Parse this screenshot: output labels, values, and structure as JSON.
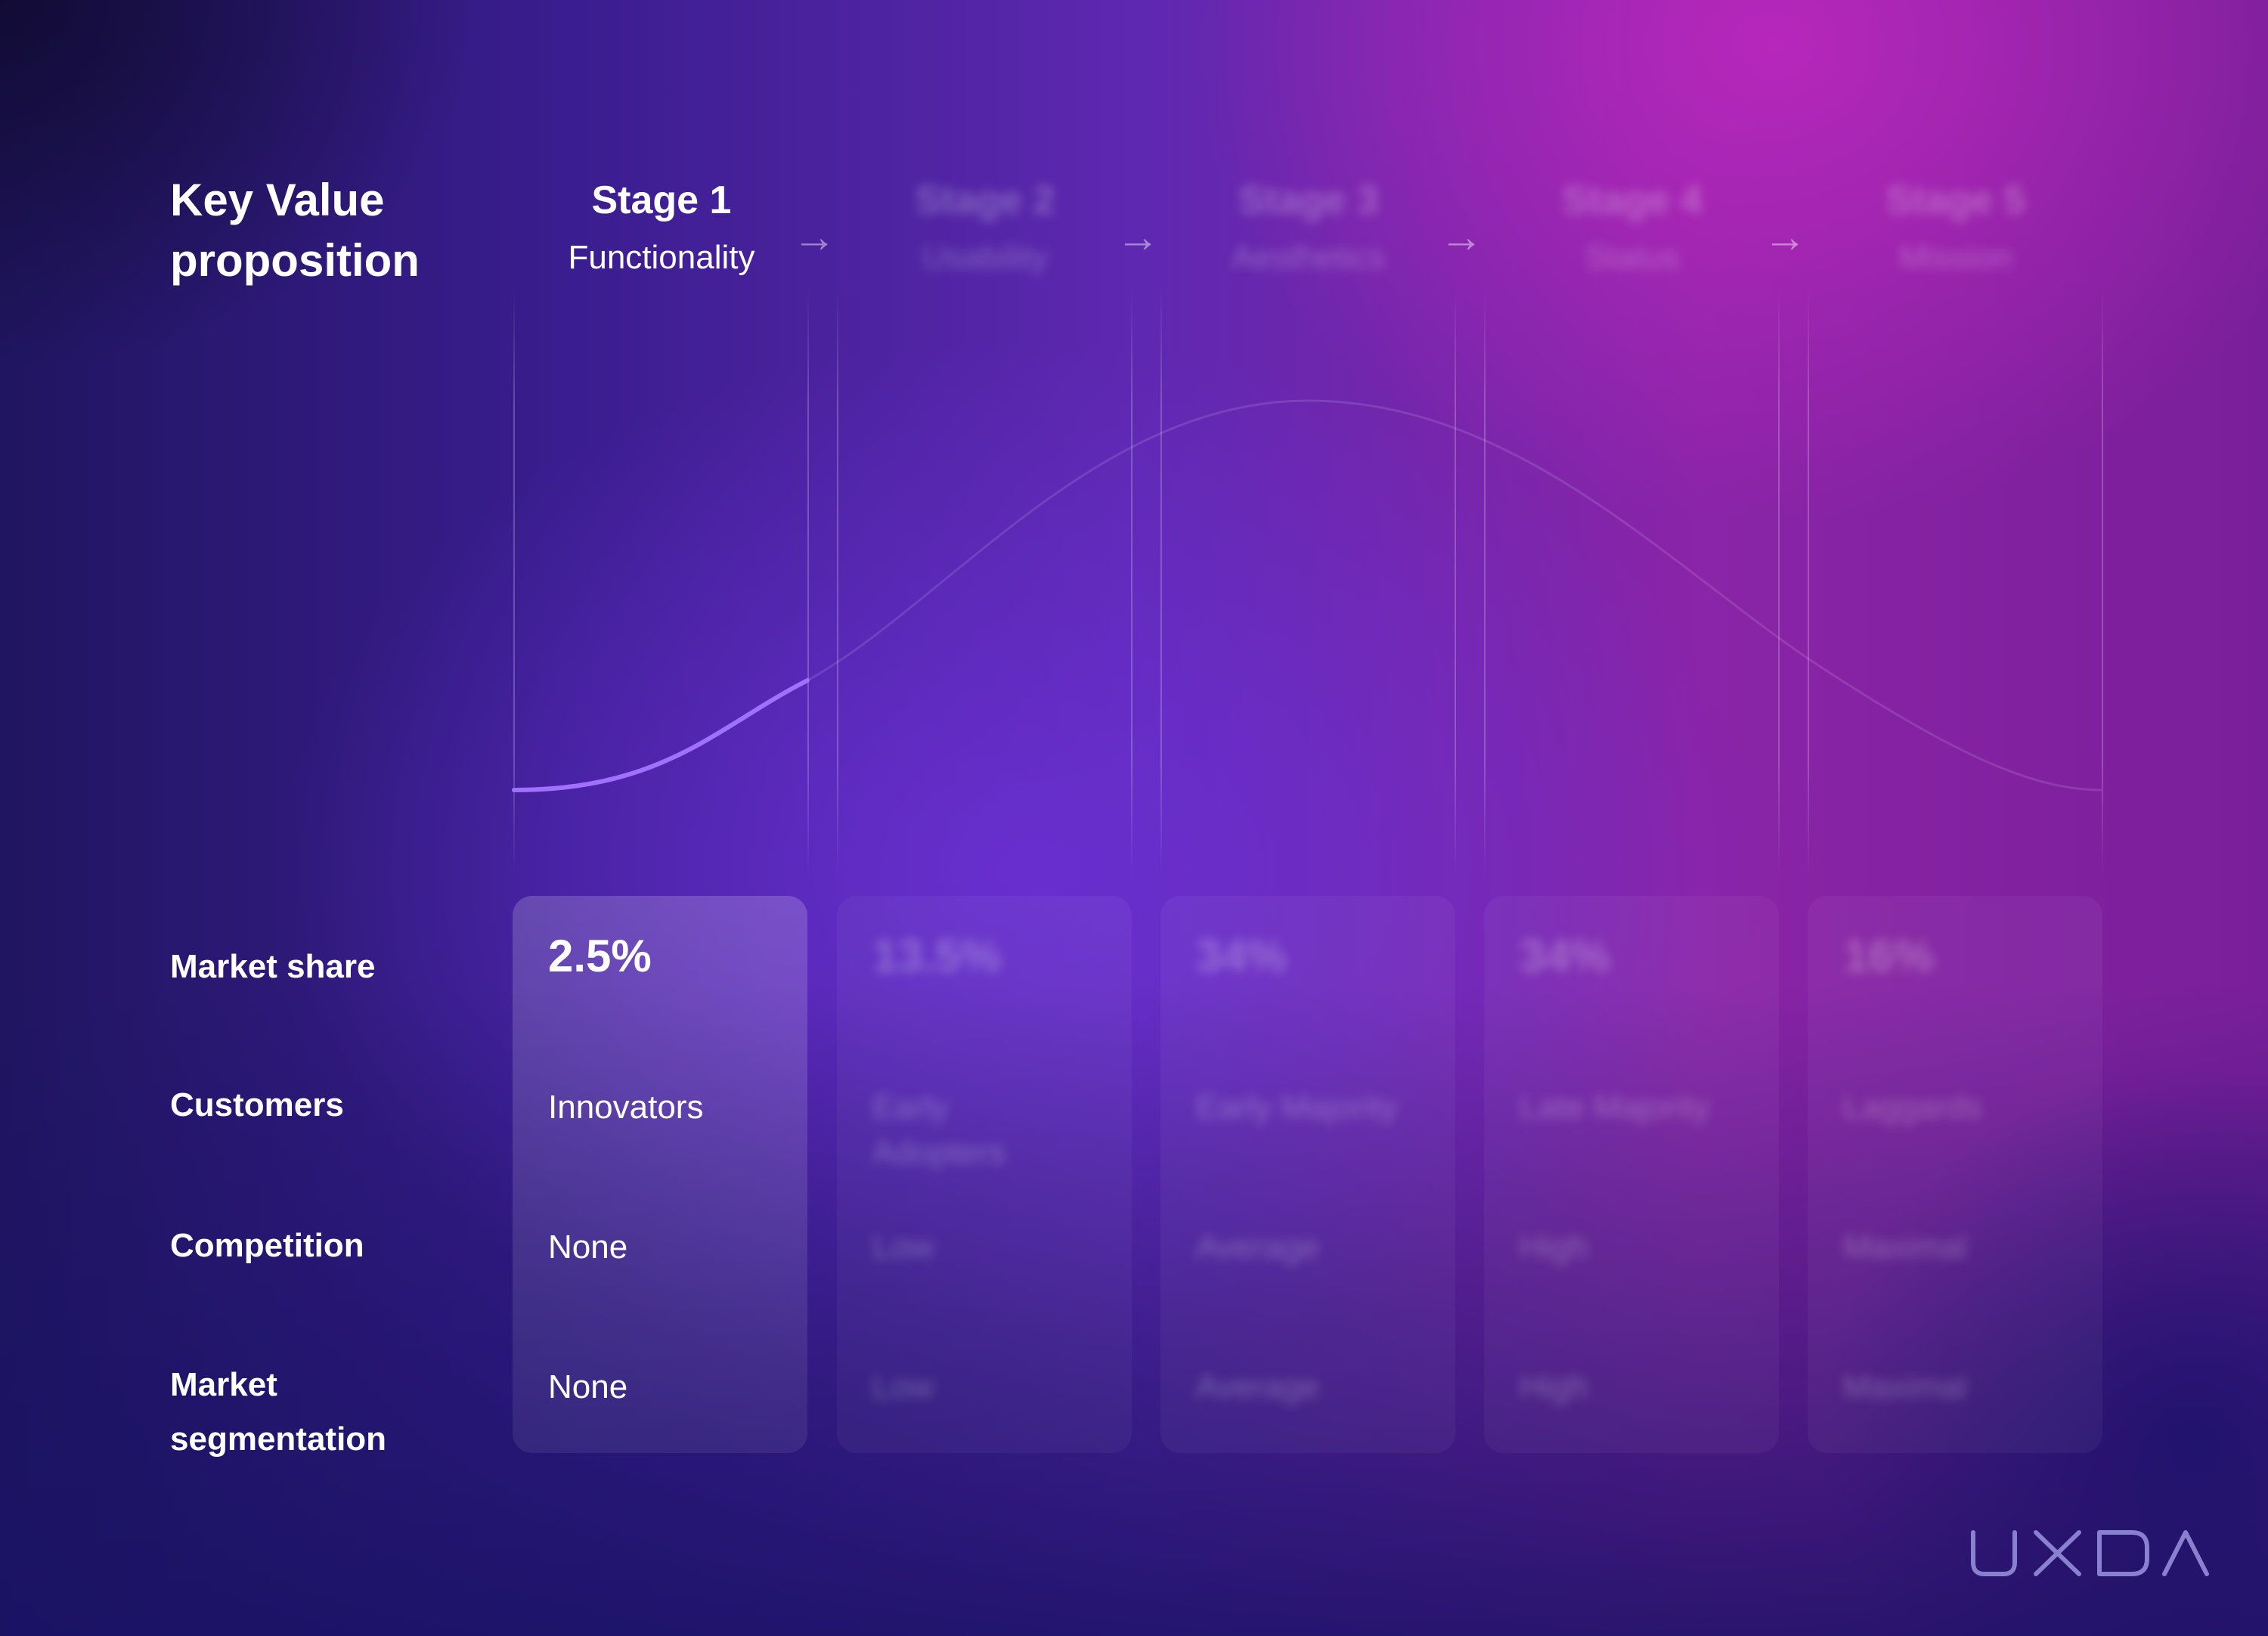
{
  "title": "Key Value proposition",
  "stages": [
    {
      "name": "Stage 1",
      "subtitle": "Functionality",
      "active": true
    },
    {
      "name": "Stage 2",
      "subtitle": "Usability",
      "active": false
    },
    {
      "name": "Stage 3",
      "subtitle": "Aesthetics",
      "active": false
    },
    {
      "name": "Stage 4",
      "subtitle": "Status",
      "active": false
    },
    {
      "name": "Stage 5",
      "subtitle": "Mission",
      "active": false
    }
  ],
  "row_labels": {
    "market_share": "Market share",
    "customers": "Customers",
    "competition": "Competition",
    "segmentation": "Market segmentation"
  },
  "table": [
    {
      "market_share": "2.5%",
      "customers": "Innovators",
      "competition": "None",
      "segmentation": "None"
    },
    {
      "market_share": "13.5%",
      "customers": "Early Adopters",
      "competition": "Low",
      "segmentation": "Low"
    },
    {
      "market_share": "34%",
      "customers": "Early Majority",
      "competition": "Average",
      "segmentation": "Average"
    },
    {
      "market_share": "34%",
      "customers": "Late Majority",
      "competition": "High",
      "segmentation": "High"
    },
    {
      "market_share": "16%",
      "customers": "Laggards",
      "competition": "Maximal",
      "segmentation": "Maximal"
    }
  ],
  "arrow_icon": "arrow-right-icon",
  "logo": "UXDA",
  "colors": {
    "curve_active": "#a070ff",
    "curve_faded": "#ffffff"
  }
}
